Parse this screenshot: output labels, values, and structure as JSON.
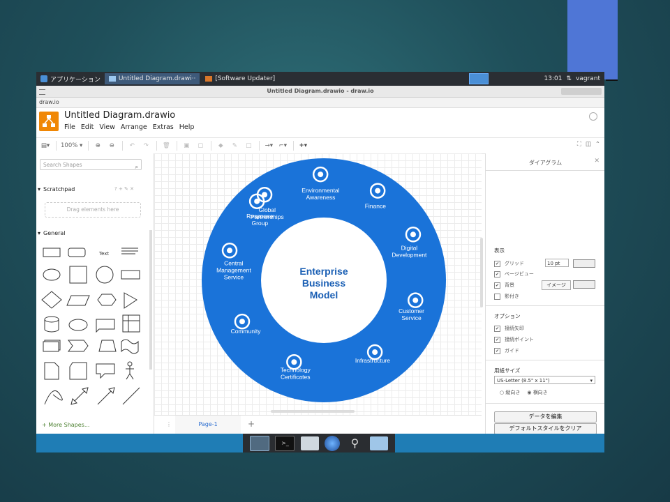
{
  "os_panel": {
    "start_label": "アプリケーション",
    "tasks": [
      {
        "label": "Untitled Diagram.drawi··",
        "active": true
      },
      {
        "label": "[Software Updater]",
        "active": false
      }
    ],
    "clock": "13:01",
    "user": "vagrant"
  },
  "window": {
    "title": "Untitled Diagram.drawio - draw.io",
    "url": "draw.io"
  },
  "app": {
    "doc_title": "Untitled Diagram.drawio",
    "menu": [
      "File",
      "Edit",
      "View",
      "Arrange",
      "Extras",
      "Help"
    ]
  },
  "toolbar": {
    "zoom": "100%"
  },
  "sidebar": {
    "search_placeholder": "Search Shapes",
    "scratchpad_label": "Scratchpad",
    "scratchpad_tools": "? + ✎ ✕",
    "drop_hint": "Drag elements here",
    "general_label": "General",
    "text_shape": "Text",
    "more_shapes": "+ More Shapes..."
  },
  "diagram": {
    "center_line1": "Enterprise",
    "center_line2": "Business",
    "center_line3": "Model",
    "ring_color": "#1a73d9",
    "center_text_color": "#1a5fb4",
    "segments": [
      {
        "l1": "Global",
        "l2": "Partnerships"
      },
      {
        "l1": "Environmental",
        "l2": "Awareness"
      },
      {
        "l1": "Finance",
        "l2": ""
      },
      {
        "l1": "Digital",
        "l2": "Development"
      },
      {
        "l1": "Customer",
        "l2": "Service"
      },
      {
        "l1": "Infrastructure",
        "l2": ""
      },
      {
        "l1": "Technology",
        "l2": "Certificates"
      },
      {
        "l1": "Community",
        "l2": ""
      },
      {
        "l1": "Central",
        "l2": "Management",
        "l3": "Service"
      },
      {
        "l1": "Response",
        "l2": "Group"
      }
    ]
  },
  "pagebar": {
    "page_tab": "Page-1"
  },
  "format_panel": {
    "title": "ダイアグラム",
    "display_section": "表示",
    "grid": "グリッド",
    "grid_size": "10 pt",
    "page_view": "ページビュー",
    "background": "背景",
    "image_button": "イメージ",
    "shadow": "影付き",
    "options_section": "オプション",
    "connection_arrows": "接続矢印",
    "connection_points": "接続ポイント",
    "guides": "ガイド",
    "paper_section": "用紙サイズ",
    "paper_value": "US-Letter (8.5\" x 11\")",
    "portrait": "縦向き",
    "landscape": "横向き",
    "edit_data": "データを編集",
    "clear_style": "デフォルトスタイルをクリア"
  }
}
